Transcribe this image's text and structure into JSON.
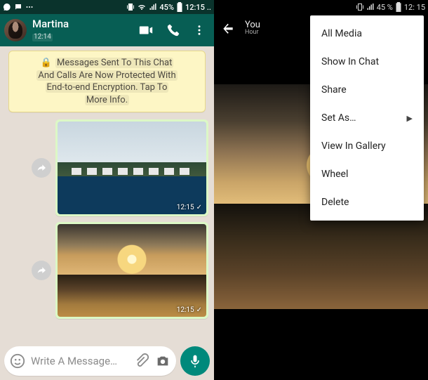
{
  "left": {
    "status": {
      "battery": "45%",
      "time": "12:15",
      "dots": ".."
    },
    "appbar": {
      "name": "Martina",
      "subtitle": "12:14"
    },
    "encryption": {
      "line1": "Messages Sent To This Chat",
      "line2": "And Calls Are Now Protected With",
      "line3": "End-to-end Encryption. Tap To",
      "line4": "More Info."
    },
    "messages": [
      {
        "time": "12:15",
        "tick": "✓"
      },
      {
        "time": "12:15",
        "tick": "✓"
      }
    ],
    "input": {
      "placeholder": "Write A Message…"
    }
  },
  "right": {
    "status": {
      "battery": "45 %",
      "time": "12: 15"
    },
    "header": {
      "title": "You",
      "subtitle": "Hour"
    },
    "menu": {
      "items": [
        "All Media",
        "Show In Chat",
        "Share",
        "Set As…",
        "View In Gallery",
        "Wheel",
        "Delete"
      ],
      "submenu_index": 3
    }
  }
}
